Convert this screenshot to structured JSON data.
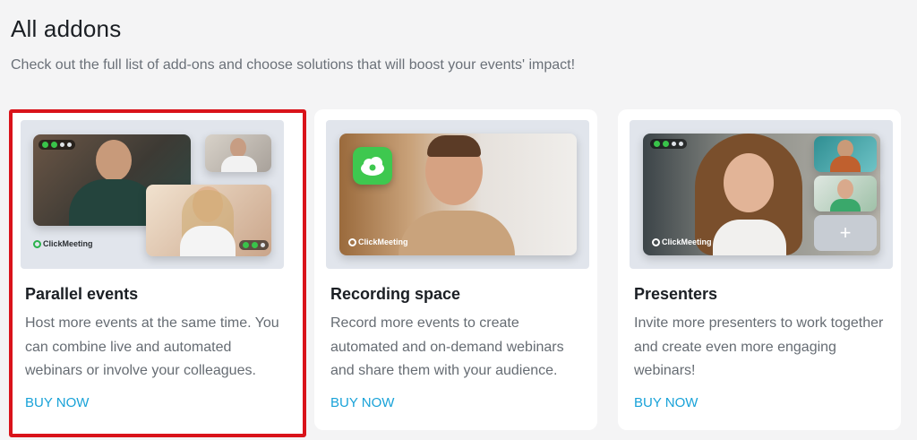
{
  "header": {
    "title": "All addons",
    "subtitle": "Check out the full list of add-ons and choose solutions that will boost your events' impact!"
  },
  "cards": [
    {
      "title": "Parallel events",
      "description": "Host more events at the same time. You can combine live and automated webinars or involve your colleagues.",
      "buy_label": "BUY NOW",
      "logo_text": "ClickMeeting",
      "highlighted": true
    },
    {
      "title": "Recording space",
      "description": "Record more events to create automated and on-demand webinars and share them with your audience.",
      "buy_label": "BUY NOW",
      "logo_text": "ClickMeeting",
      "icon": "cloud-icon"
    },
    {
      "title": "Presenters",
      "description": "Invite more presenters to work together and create even more engaging webinars!",
      "buy_label": "BUY NOW",
      "logo_text": "ClickMeeting",
      "icon": "plus-icon"
    }
  ],
  "colors": {
    "background": "#f4f4f5",
    "card": "#ffffff",
    "highlight_border": "#d9131a",
    "link": "#18a2d8",
    "brand_green": "#2ab24c"
  }
}
